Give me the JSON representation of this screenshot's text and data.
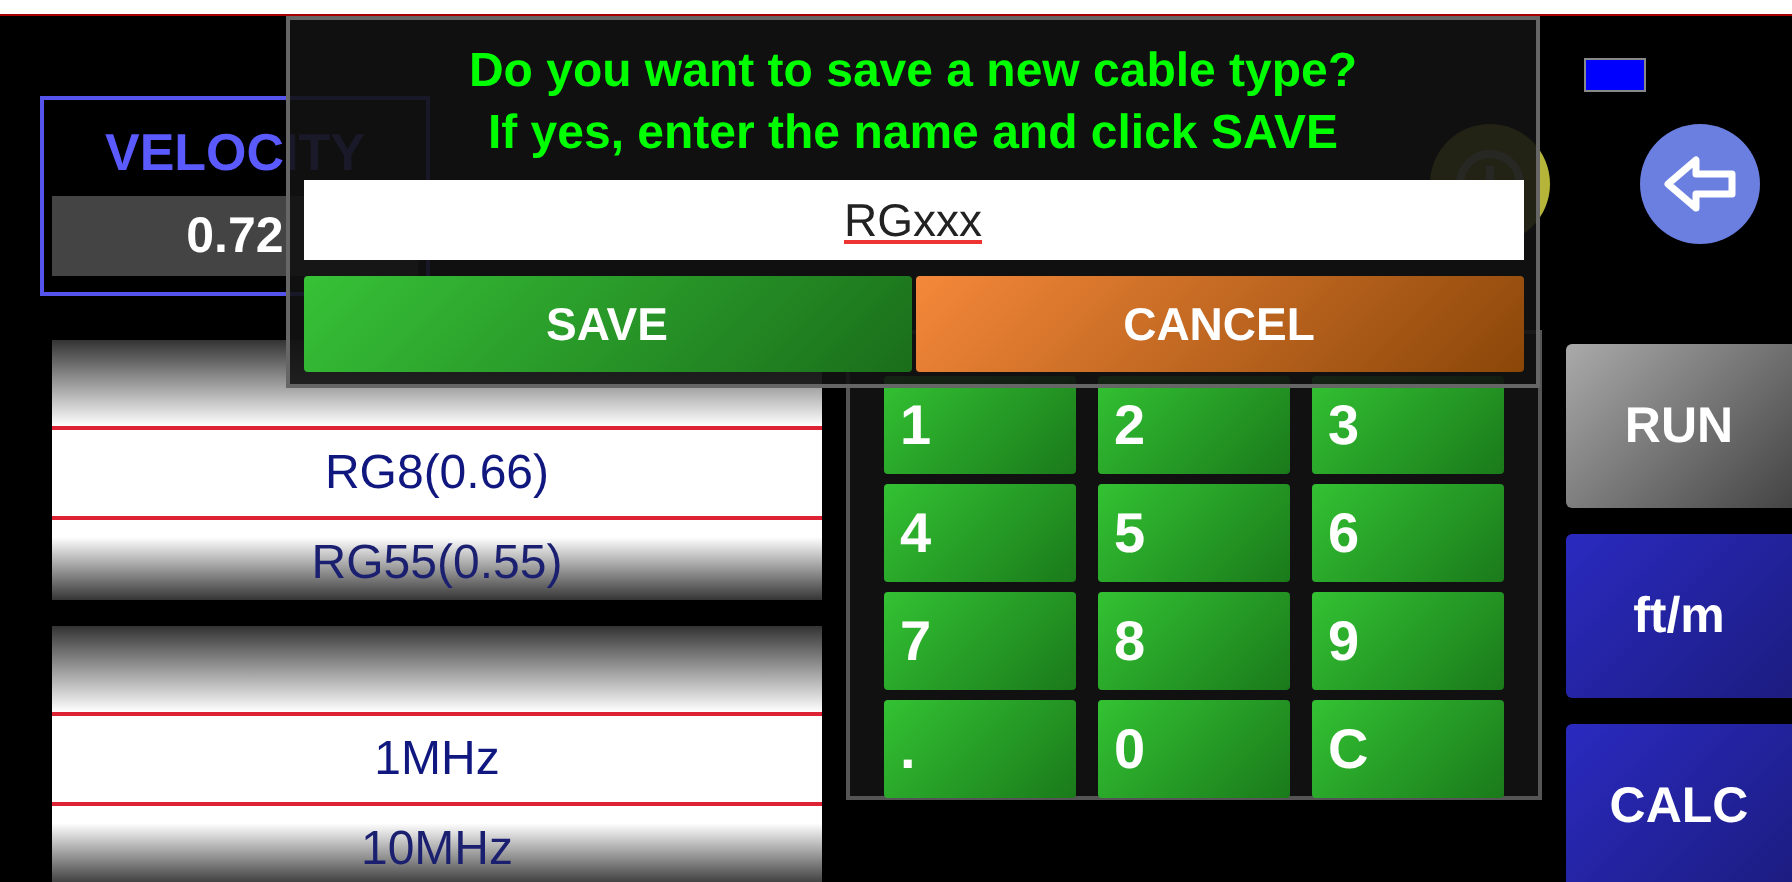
{
  "background": {
    "velocity": {
      "label": "VELOCITY",
      "value": "0.72"
    }
  },
  "pickers": [
    {
      "items": [
        {
          "label": "RG8(0.66)",
          "selected": true
        },
        {
          "label": "RG55(0.55)",
          "selected": false
        }
      ]
    },
    {
      "items": [
        {
          "label": "1MHz",
          "selected": true
        },
        {
          "label": "10MHz",
          "selected": false
        }
      ]
    }
  ],
  "keypad": [
    "1",
    "2",
    "3",
    "4",
    "5",
    "6",
    "7",
    "8",
    "9",
    ".",
    "0",
    "C"
  ],
  "side_buttons": [
    {
      "label": "RUN",
      "kind": "plain"
    },
    {
      "label": "ft/m",
      "kind": "accent"
    },
    {
      "label": "CALC",
      "kind": "accent"
    }
  ],
  "dialog": {
    "message": [
      "Do you want to save a new cable type?",
      "If yes, enter the name and click SAVE"
    ],
    "input_value": "RGxxx",
    "buttons": [
      {
        "label": "SAVE",
        "kind": "confirm"
      },
      {
        "label": "CANCEL",
        "kind": "cancel"
      }
    ]
  }
}
